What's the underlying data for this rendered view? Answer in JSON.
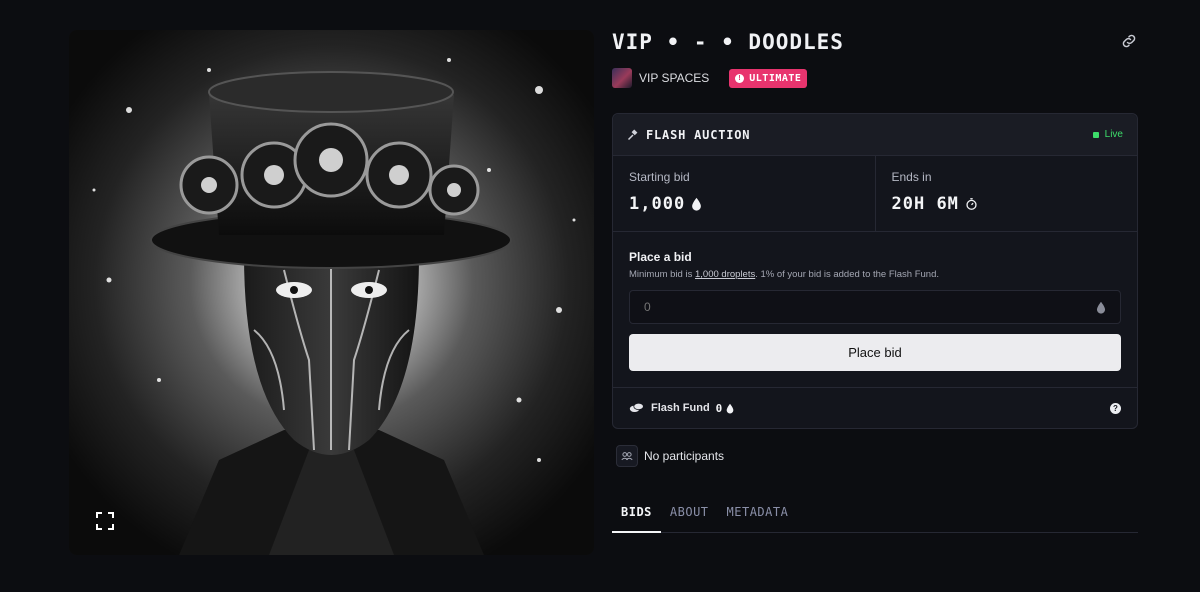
{
  "nft": {
    "title": "VIP • - • DOODLES",
    "creator_name": "VIP SPACES",
    "tier_badge": "ULTIMATE",
    "artwork_alt": "Steampunk figure with gear top hat"
  },
  "auction": {
    "label": "FLASH AUCTION",
    "status": "Live",
    "starting_bid_label": "Starting bid",
    "starting_bid_value": "1,000",
    "ends_label": "Ends in",
    "ends_value": "20H 6M",
    "place_title": "Place a bid",
    "note_prefix": "Minimum bid is ",
    "note_link": "1,000 droplets",
    "note_suffix": ". 1% of your bid is added to the Flash Fund.",
    "input_placeholder": "0",
    "place_button": "Place bid",
    "fund_label": "Flash Fund",
    "fund_value": "0"
  },
  "participants": {
    "text": "No participants"
  },
  "tabs": [
    {
      "label": "BIDS",
      "active": true
    },
    {
      "label": "ABOUT",
      "active": false
    },
    {
      "label": "METADATA",
      "active": false
    }
  ],
  "colors": {
    "background": "#0c0d11",
    "accent_pink": "#e8346e",
    "live_green": "#3ddc6a",
    "button_bg": "#ececef"
  },
  "icons": [
    "expand-icon",
    "link-icon",
    "hammer-icon",
    "droplet-icon",
    "timer-icon",
    "coins-icon",
    "help-icon",
    "users-icon"
  ]
}
